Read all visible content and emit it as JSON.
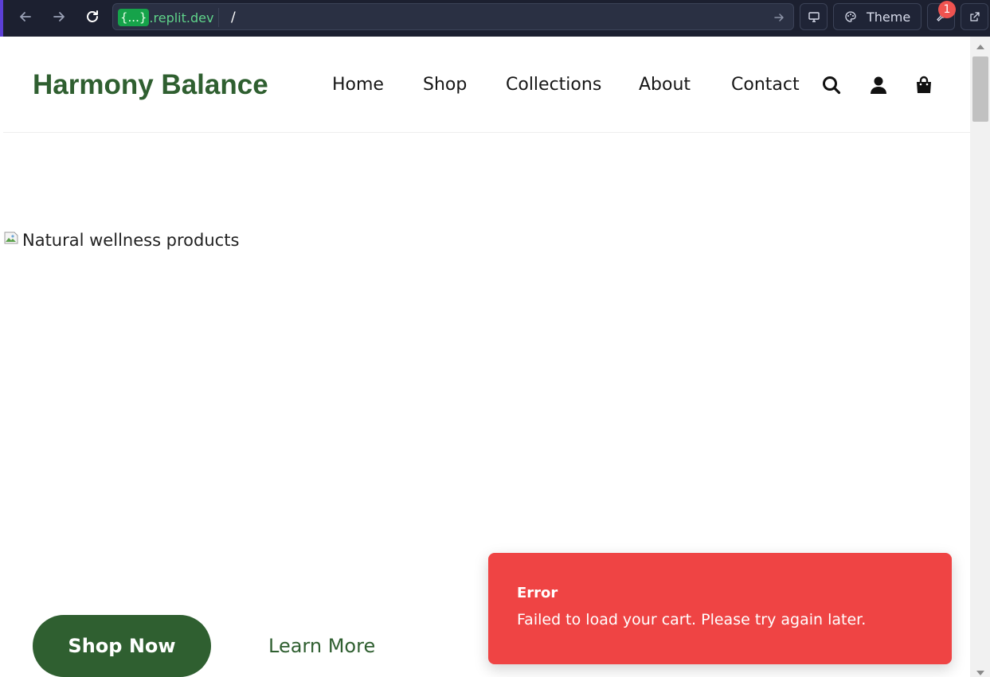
{
  "browser": {
    "url_token": "{...}",
    "url_domain": ".replit.dev",
    "url_path": "/",
    "theme_label": "Theme",
    "devtools_badge": "1"
  },
  "site": {
    "logo": "Harmony Balance",
    "nav": [
      "Home",
      "Shop",
      "Collections",
      "About",
      "Contact"
    ],
    "icons": [
      "search-icon",
      "user-icon",
      "shopping-bag-icon"
    ],
    "brand_color": "#2f5f30"
  },
  "hero": {
    "image_alt": "Natural wellness products",
    "primary_cta": "Shop Now",
    "secondary_cta": "Learn More"
  },
  "toast": {
    "title": "Error",
    "message": "Failed to load your cart. Please try again later.",
    "color": "#ef4444"
  }
}
